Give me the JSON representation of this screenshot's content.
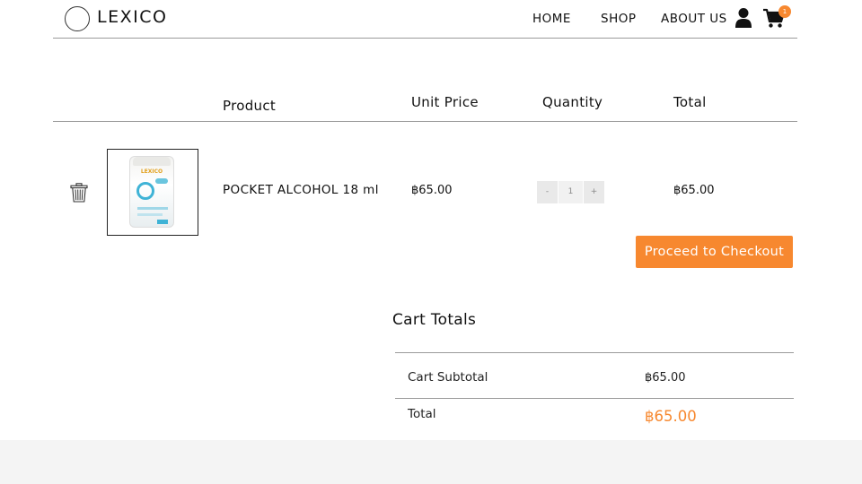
{
  "brand": {
    "name": "LEXICO"
  },
  "nav": {
    "home": "HOME",
    "shop": "SHOP",
    "about": "ABOUT US",
    "cart_count": "1"
  },
  "cart_table": {
    "headers": {
      "product": "Product",
      "unit_price": "Unit Price",
      "quantity": "Quantity",
      "total": "Total"
    },
    "items": [
      {
        "name": "POCKET ALCOHOL 18 ml",
        "unit_price": "฿65.00",
        "quantity": "1",
        "total": "฿65.00",
        "thumbnail_brand": "LEXICO"
      }
    ],
    "qty_minus": "-",
    "qty_plus": "+"
  },
  "checkout": {
    "label": "Proceed to Checkout"
  },
  "cart_totals": {
    "title": "Cart Totals",
    "subtotal_label": "Cart Subtotal",
    "subtotal_value": "฿65.00",
    "total_label": "Total",
    "total_value": "฿65.00"
  },
  "colors": {
    "accent": "#f7882f",
    "footer_bg": "#f4f4f4",
    "divider": "#9a9a9a"
  },
  "icons": [
    "logo-circle-icon",
    "user-icon",
    "cart-icon",
    "trash-icon"
  ]
}
